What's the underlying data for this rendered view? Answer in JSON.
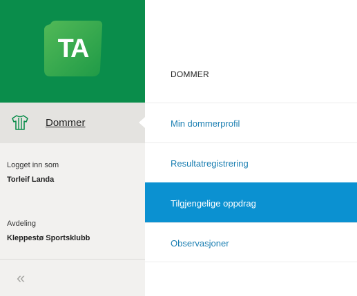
{
  "brand": {
    "logo_text": "TA",
    "color": "#0a8d4b"
  },
  "sidebar": {
    "role": {
      "icon": "jersey-icon",
      "label": "Dommer"
    },
    "logged_in_label": "Logget inn som",
    "user_name": "Torleif Landa",
    "department_label": "Avdeling",
    "department_name": "Kleppestø Sportsklubb",
    "collapse_icon": "double-chevron-left-icon",
    "collapse_glyph": "«"
  },
  "main": {
    "section_title": "DOMMER",
    "menu": [
      {
        "label": "Min dommerprofil",
        "active": false
      },
      {
        "label": "Resultatregistrering",
        "active": false
      },
      {
        "label": "Tilgjengelige oppdrag",
        "active": true
      },
      {
        "label": "Observasjoner",
        "active": false
      }
    ],
    "accent_color": "#0b91d1",
    "link_color": "#1b7fb2"
  }
}
